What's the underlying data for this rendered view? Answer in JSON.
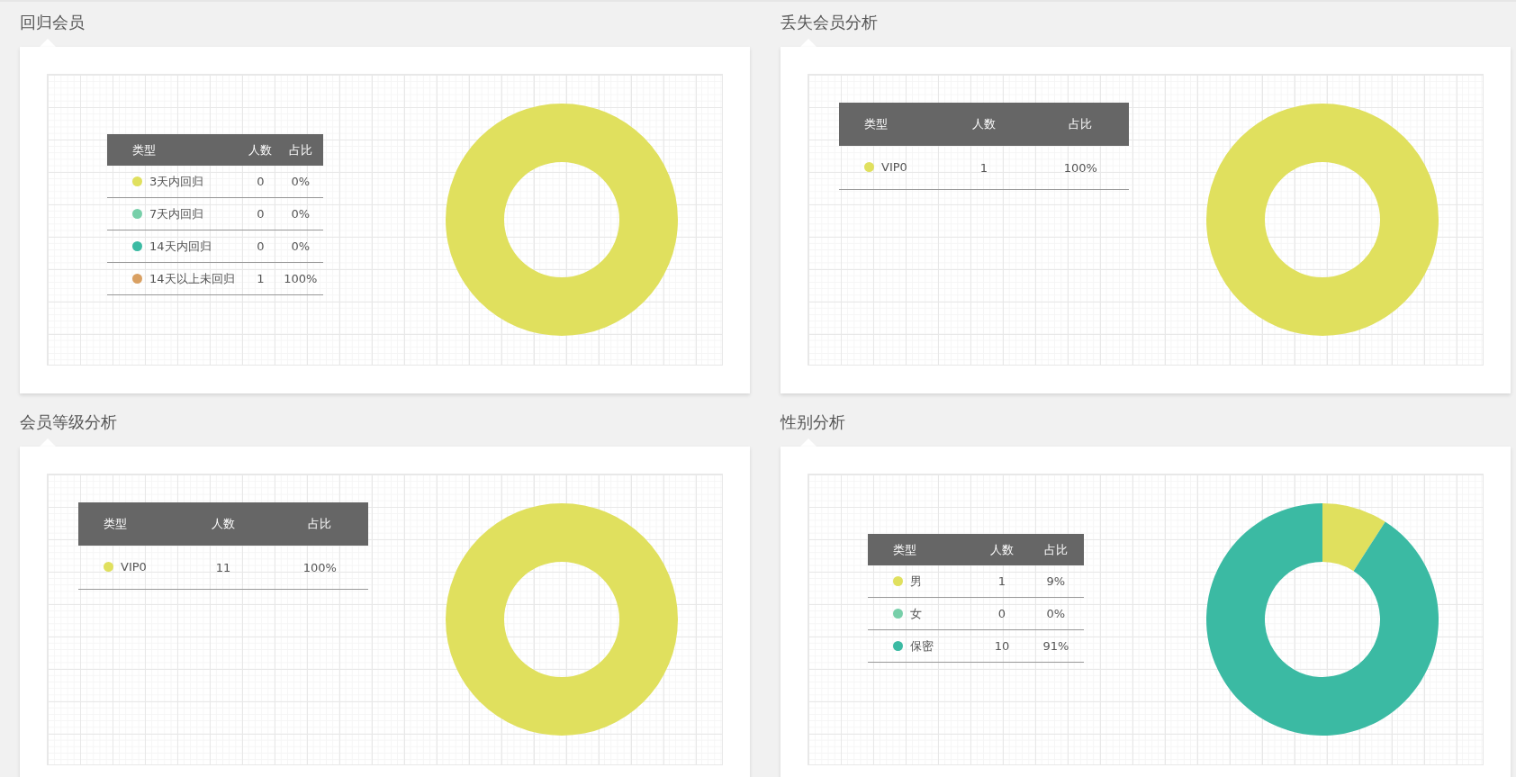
{
  "cards": [
    {
      "title": "回归会员",
      "kind": "compact",
      "columns": [
        "类型",
        "人数",
        "占比"
      ],
      "rows": [
        {
          "name": "3天内回归",
          "count": "0",
          "share": "0%",
          "color": "#e0e05e"
        },
        {
          "name": "7天内回归",
          "count": "0",
          "share": "0%",
          "color": "#77cfa9"
        },
        {
          "name": "14天内回归",
          "count": "0",
          "share": "0%",
          "color": "#3bbaa3"
        },
        {
          "name": "14天以上未回归",
          "count": "1",
          "share": "100%",
          "color": "#d9a062"
        }
      ],
      "slices": [
        {
          "color": "#e0e05e"
        }
      ]
    },
    {
      "title": "丢失会员分析",
      "kind": "wide",
      "columns": [
        "类型",
        "人数",
        "占比"
      ],
      "rows": [
        {
          "name": "VIP0",
          "count": "1",
          "share": "100%",
          "color": "#e0e05e"
        }
      ],
      "slices": [
        {
          "color": "#e0e05e"
        }
      ]
    },
    {
      "title": "会员等级分析",
      "kind": "wide",
      "columns": [
        "类型",
        "人数",
        "占比"
      ],
      "rows": [
        {
          "name": "VIP0",
          "count": "11",
          "share": "100%",
          "color": "#e0e05e"
        }
      ],
      "slices": [
        {
          "color": "#e0e05e"
        }
      ]
    },
    {
      "title": "性别分析",
      "kind": "compact",
      "columns": [
        "类型",
        "人数",
        "占比"
      ],
      "rows": [
        {
          "name": "男",
          "count": "1",
          "share": "9%",
          "color": "#e0e05e"
        },
        {
          "name": "女",
          "count": "0",
          "share": "0%",
          "color": "#77cfa9"
        },
        {
          "name": "保密",
          "count": "10",
          "share": "91%",
          "color": "#3bbaa3"
        }
      ],
      "slices": [
        {
          "color": "#e0e05e"
        },
        {
          "color": "#3bbaa3"
        }
      ]
    }
  ]
}
